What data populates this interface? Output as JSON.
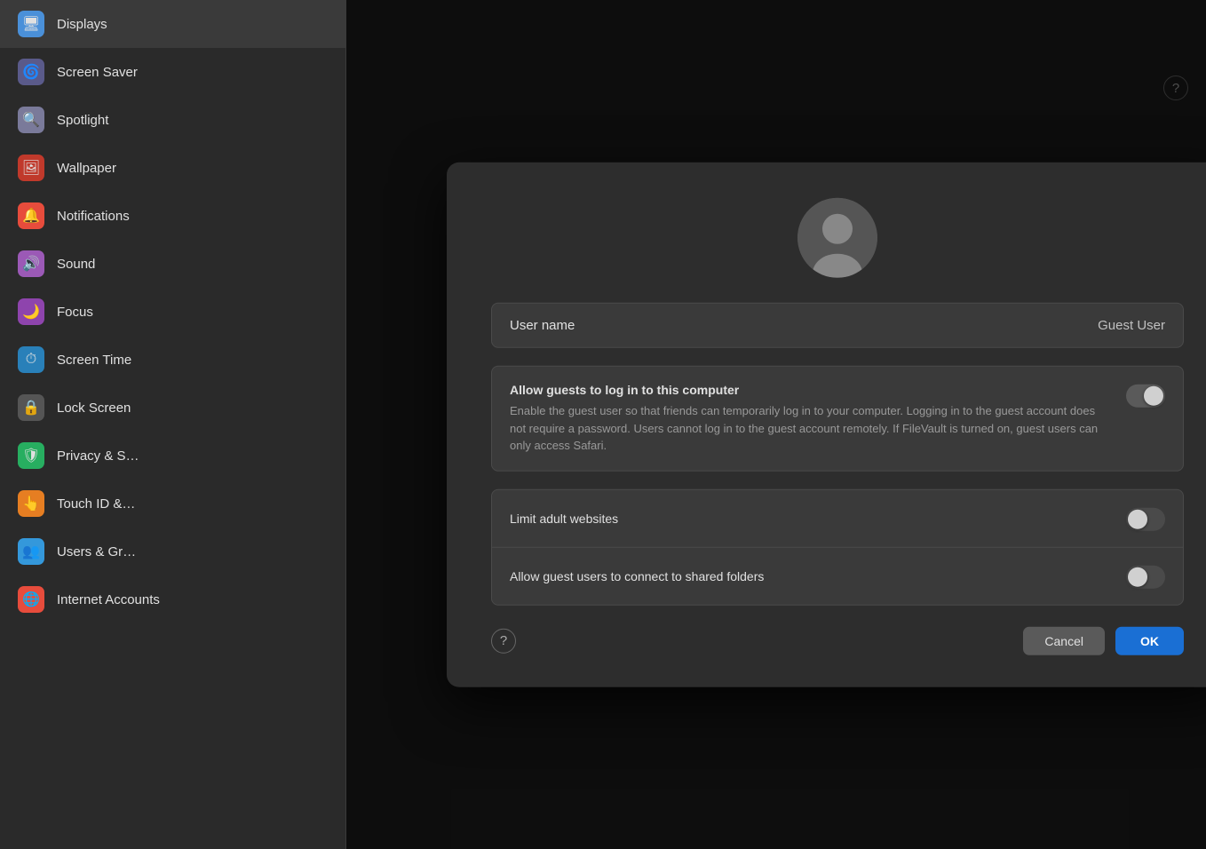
{
  "sidebar": {
    "items": [
      {
        "id": "displays",
        "label": "Displays",
        "icon": "🖥",
        "icon_class": "icon-displays"
      },
      {
        "id": "screensaver",
        "label": "Screen Saver",
        "icon": "🌀",
        "icon_class": "icon-screensaver"
      },
      {
        "id": "spotlight",
        "label": "Spotlight",
        "icon": "🔍",
        "icon_class": "icon-spotlight"
      },
      {
        "id": "wallpaper",
        "label": "Wallpaper",
        "icon": "🖼",
        "icon_class": "icon-wallpaper"
      },
      {
        "id": "notifications",
        "label": "Notifications",
        "icon": "🔔",
        "icon_class": "icon-notifications"
      },
      {
        "id": "sound",
        "label": "Sound",
        "icon": "🔊",
        "icon_class": "icon-sound"
      },
      {
        "id": "focus",
        "label": "Focus",
        "icon": "🌙",
        "icon_class": "icon-focus"
      },
      {
        "id": "screentime",
        "label": "Screen Time",
        "icon": "⏱",
        "icon_class": "icon-screentime"
      },
      {
        "id": "lockscreen",
        "label": "Lock Screen",
        "icon": "🔒",
        "icon_class": "icon-lockscreen"
      },
      {
        "id": "privacy",
        "label": "Privacy & S…",
        "icon": "🛡",
        "icon_class": "icon-privacy"
      },
      {
        "id": "touchid",
        "label": "Touch ID &…",
        "icon": "👆",
        "icon_class": "icon-touchid"
      },
      {
        "id": "users",
        "label": "Users & Gr…",
        "icon": "👥",
        "icon_class": "icon-users"
      },
      {
        "id": "internetaccounts",
        "label": "Internet Accounts",
        "icon": "🌐",
        "icon_class": "icon-internetaccounts"
      }
    ]
  },
  "modal": {
    "username_label": "User name",
    "username_value": "Guest User",
    "allow_guests_title": "Allow guests to log in to this computer",
    "allow_guests_desc": "Enable the guest user so that friends can temporarily log in to your computer. Logging in to the guest account does not require a password. Users cannot log in to the guest account remotely. If FileVault is turned on, guest users can only access Safari.",
    "allow_guests_toggle": "on",
    "limit_adult_title": "Limit adult websites",
    "limit_adult_toggle": "off",
    "shared_folders_title": "Allow guest users to connect to shared folders",
    "shared_folders_toggle": "off",
    "cancel_label": "Cancel",
    "ok_label": "OK",
    "help_icon": "?"
  },
  "help_icon": "?"
}
